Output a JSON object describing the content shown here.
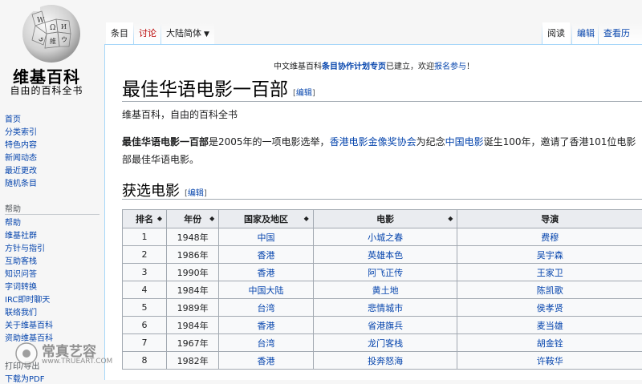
{
  "sidebar": {
    "site_name": "维基百科",
    "tagline": "自由的百科全书",
    "nav": [
      {
        "label": "首页"
      },
      {
        "label": "分类索引"
      },
      {
        "label": "特色内容"
      },
      {
        "label": "新闻动态"
      },
      {
        "label": "最近更改"
      },
      {
        "label": "随机条目"
      }
    ],
    "help_heading": "帮助",
    "help": [
      {
        "label": "帮助"
      },
      {
        "label": "维基社群"
      },
      {
        "label": "方针与指引"
      },
      {
        "label": "互助客栈"
      },
      {
        "label": "知识问答"
      },
      {
        "label": "字词转换"
      },
      {
        "label": "IRC即时聊天"
      },
      {
        "label": "联络我们"
      },
      {
        "label": "关于维基百科"
      },
      {
        "label": "资助维基百科"
      }
    ],
    "tools_partial": "打印/导出",
    "pdf_partial": "下载为PDF"
  },
  "tabs": {
    "article": "条目",
    "talk": "讨论",
    "variant": "大陆简体",
    "read": "阅读",
    "edit": "编辑",
    "history": "查看历史"
  },
  "notice": {
    "prefix": "中文维基百科",
    "bold": "条目协作计划专页",
    "middle": "已建立，欢迎",
    "link": "报名参与",
    "suffix": "！"
  },
  "article": {
    "title": "最佳华语电影一百部",
    "edit_label": "编辑",
    "site_sub": "维基百科，自由的百科全书",
    "intro": {
      "bold": "最佳华语电影一百部",
      "t1": "是2005年的一项电影选举，",
      "l1": "香港电影金像奖协会",
      "t2": "为纪念",
      "l2": "中国电影",
      "t3": "诞生100年，邀请了香港101位电影",
      "t4": "部最佳华语电影。"
    },
    "section_title": "获选电影",
    "section_edit": "编辑"
  },
  "table": {
    "headers": [
      "排名",
      "年份",
      "国家及地区",
      "电影",
      "导演"
    ],
    "rows": [
      [
        "1",
        "1948年",
        "中国",
        "小城之春",
        "费穆"
      ],
      [
        "2",
        "1986年",
        "香港",
        "英雄本色",
        "吴宇森"
      ],
      [
        "3",
        "1990年",
        "香港",
        "阿飞正传",
        "王家卫"
      ],
      [
        "4",
        "1984年",
        "中国大陆",
        "黄土地",
        "陈凯歌"
      ],
      [
        "5",
        "1989年",
        "台湾",
        "悲情城市",
        "侯孝贤"
      ],
      [
        "6",
        "1984年",
        "香港",
        "省港旗兵",
        "麦当雄"
      ],
      [
        "7",
        "1967年",
        "台湾",
        "龙门客栈",
        "胡金铨"
      ],
      [
        "8",
        "1982年",
        "香港",
        "投奔怒海",
        "许鞍华"
      ]
    ]
  },
  "watermark": {
    "name": "常真艺容",
    "url": "www.TRUEART.COM"
  },
  "colors": {
    "link": "#0645ad",
    "header_bg": "#eaecf0",
    "border": "#a2a9b1",
    "tab_border": "#a7d7f9"
  }
}
